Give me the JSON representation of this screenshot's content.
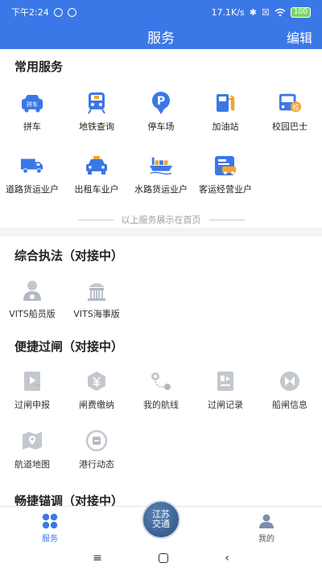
{
  "status": {
    "time": "下午2:24",
    "speed": "17.1K/s",
    "battery": "100"
  },
  "nav": {
    "title": "服务",
    "edit": "编辑"
  },
  "common": {
    "title": "常用服务",
    "items": [
      {
        "label": "拼车",
        "icon": "carpool-icon",
        "badge": "拼车"
      },
      {
        "label": "地铁查询",
        "icon": "metro-icon"
      },
      {
        "label": "停车场",
        "icon": "parking-icon",
        "badge": "P"
      },
      {
        "label": "加油站",
        "icon": "gas-station-icon"
      },
      {
        "label": "校园巴士",
        "icon": "school-bus-icon",
        "badge": "校"
      },
      {
        "label": "道路货运业户",
        "icon": "truck-icon"
      },
      {
        "label": "出租车业户",
        "icon": "taxi-icon"
      },
      {
        "label": "水路货运业户",
        "icon": "cargo-ship-icon"
      },
      {
        "label": "客运经营业户",
        "icon": "passenger-transport-icon"
      }
    ],
    "hint": "以上服务展示在首页"
  },
  "law": {
    "title": "综合执法（对接中）",
    "items": [
      {
        "label": "VITS船员版",
        "icon": "crew-icon"
      },
      {
        "label": "VITS海事版",
        "icon": "maritime-icon"
      }
    ]
  },
  "lock": {
    "title": "便捷过闸（对接中）",
    "items": [
      {
        "label": "过闸申报",
        "icon": "lock-declare-icon"
      },
      {
        "label": "闸费缴纳",
        "icon": "fee-payment-icon"
      },
      {
        "label": "我的航线",
        "icon": "route-icon"
      },
      {
        "label": "过闸记录",
        "icon": "lock-record-icon"
      },
      {
        "label": "船闸信息",
        "icon": "lock-info-icon"
      },
      {
        "label": "航道地图",
        "icon": "waterway-map-icon"
      },
      {
        "label": "港行动态",
        "icon": "port-dynamic-icon"
      }
    ]
  },
  "anchor": {
    "title": "畅捷锚调（对接中）"
  },
  "tabs": [
    {
      "label": "服务",
      "icon": "services-grid-icon"
    },
    {
      "label": "江苏交通",
      "icon": "jiangsu-traffic-logo-icon"
    },
    {
      "label": "我的",
      "icon": "profile-icon"
    }
  ],
  "colors": {
    "primary": "#3b78e7",
    "orange": "#f2a533",
    "gray": "#b9bec6"
  }
}
